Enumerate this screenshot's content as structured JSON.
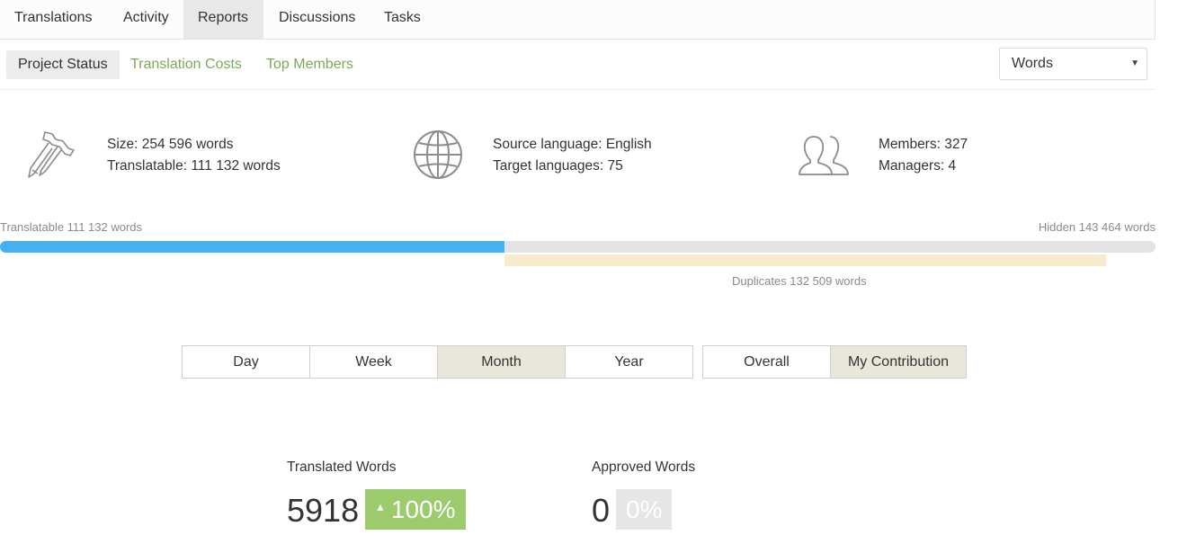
{
  "topnav": {
    "tabs": [
      {
        "label": "Translations"
      },
      {
        "label": "Activity"
      },
      {
        "label": "Reports"
      },
      {
        "label": "Discussions"
      },
      {
        "label": "Tasks"
      }
    ],
    "active": "Reports"
  },
  "subnav": {
    "items": [
      {
        "label": "Project Status"
      },
      {
        "label": "Translation Costs"
      },
      {
        "label": "Top Members"
      }
    ],
    "unit_select": "Words"
  },
  "stats": {
    "size": "Size: 254 596 words",
    "translatable": "Translatable: 111 132 words",
    "source_language": "Source language: English",
    "target_languages": "Target languages: 75",
    "members": "Members: 327",
    "managers": "Managers: 4"
  },
  "progress": {
    "translatable_label": "Translatable 111 132 words",
    "hidden_label": "Hidden 143 464 words",
    "duplicates_label": "Duplicates 132 509 words",
    "translatable_fraction": 0.4365,
    "duplicates_fraction": 0.5205
  },
  "period": {
    "options": [
      {
        "label": "Day"
      },
      {
        "label": "Week"
      },
      {
        "label": "Month"
      },
      {
        "label": "Year"
      }
    ],
    "active": "Month"
  },
  "scope": {
    "options": [
      {
        "label": "Overall"
      },
      {
        "label": "My Contribution"
      }
    ],
    "active": "My Contribution"
  },
  "metrics": {
    "translated": {
      "label": "Translated Words",
      "value": "5918",
      "change": "100%",
      "trend_glyph": "▲"
    },
    "approved": {
      "label": "Approved Words",
      "value": "0",
      "change": "0%"
    }
  },
  "colors": {
    "accent_link": "#7aa95a",
    "progress_blue": "#45b1f2",
    "duplicates": "#f8eacd",
    "badge_green": "#9ccb6e"
  },
  "icons": [
    "calipers-icon",
    "globe-icon",
    "members-icon",
    "chevron-down-icon"
  ]
}
